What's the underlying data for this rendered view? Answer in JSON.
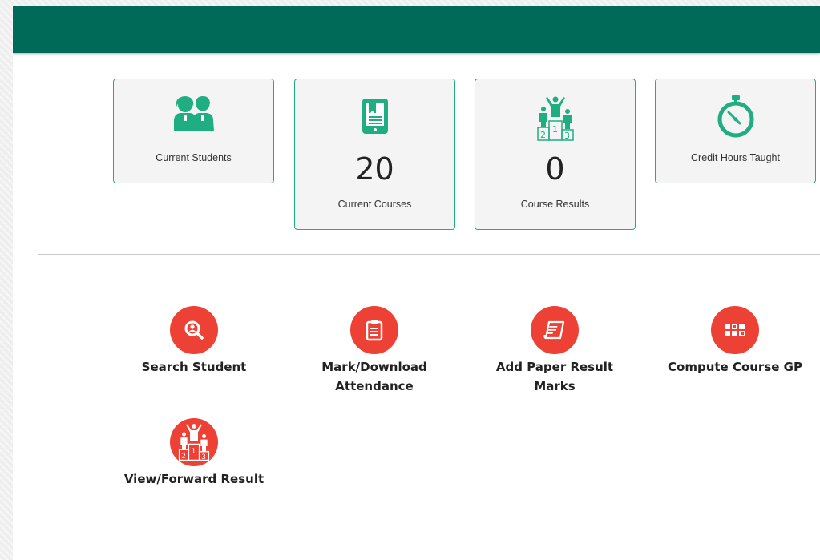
{
  "stats": [
    {
      "label": "Current Students",
      "count": "",
      "icon": "students-icon"
    },
    {
      "label": "Current Courses",
      "count": "20",
      "icon": "tablet-book-icon"
    },
    {
      "label": "Course Results",
      "count": "0",
      "icon": "podium-icon"
    },
    {
      "label": "Credit Hours Taught",
      "count": "",
      "icon": "stopwatch-icon"
    }
  ],
  "actions": [
    {
      "label": "Search Student",
      "icon": "search-student-icon"
    },
    {
      "label": "Mark/Download Attendance",
      "icon": "clipboard-icon"
    },
    {
      "label": "Add Paper Result Marks",
      "icon": "paper-scroll-icon"
    },
    {
      "label": "Compute Course GP",
      "icon": "grid-blocks-icon"
    },
    {
      "label": "View/Forward Result",
      "icon": "podium-icon"
    }
  ],
  "colors": {
    "header": "#006a59",
    "accent": "#1fae82",
    "action": "#ee4135",
    "card_bg": "#f4f4f4"
  }
}
